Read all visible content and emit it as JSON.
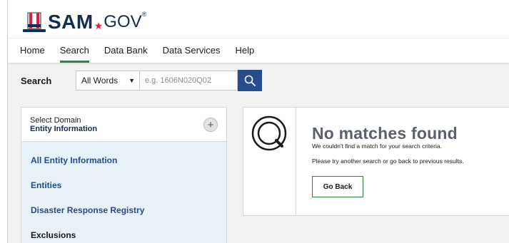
{
  "logo": {
    "brand": "SAM",
    "star": "★",
    "suffix": "GOV",
    "reg": "®"
  },
  "nav": {
    "items": [
      {
        "label": "Home"
      },
      {
        "label": "Search"
      },
      {
        "label": "Data Bank"
      },
      {
        "label": "Data Services"
      },
      {
        "label": "Help"
      }
    ],
    "active": "Search"
  },
  "search": {
    "label": "Search",
    "scope_value": "All Words",
    "placeholder": "e.g. 1606N020Q02"
  },
  "domain": {
    "heading_label": "Select Domain",
    "heading_value": "Entity Information",
    "add_symbol": "+",
    "items": [
      {
        "label": "All Entity Information"
      },
      {
        "label": "Entities"
      },
      {
        "label": "Disaster Response Registry"
      },
      {
        "label": "Exclusions"
      }
    ]
  },
  "results": {
    "title": "No matches found",
    "line1": "We couldn't find a match for your search criteria.",
    "line2": "Please try another search or go back to previous results.",
    "button": "Go Back"
  },
  "colors": {
    "navy": "#112e51",
    "accent_green": "#2e8540",
    "search_button": "#254c8e",
    "link_blue": "#254c8e",
    "panel_bg": "#f1f1f1",
    "list_bg": "#e8f0f8"
  }
}
